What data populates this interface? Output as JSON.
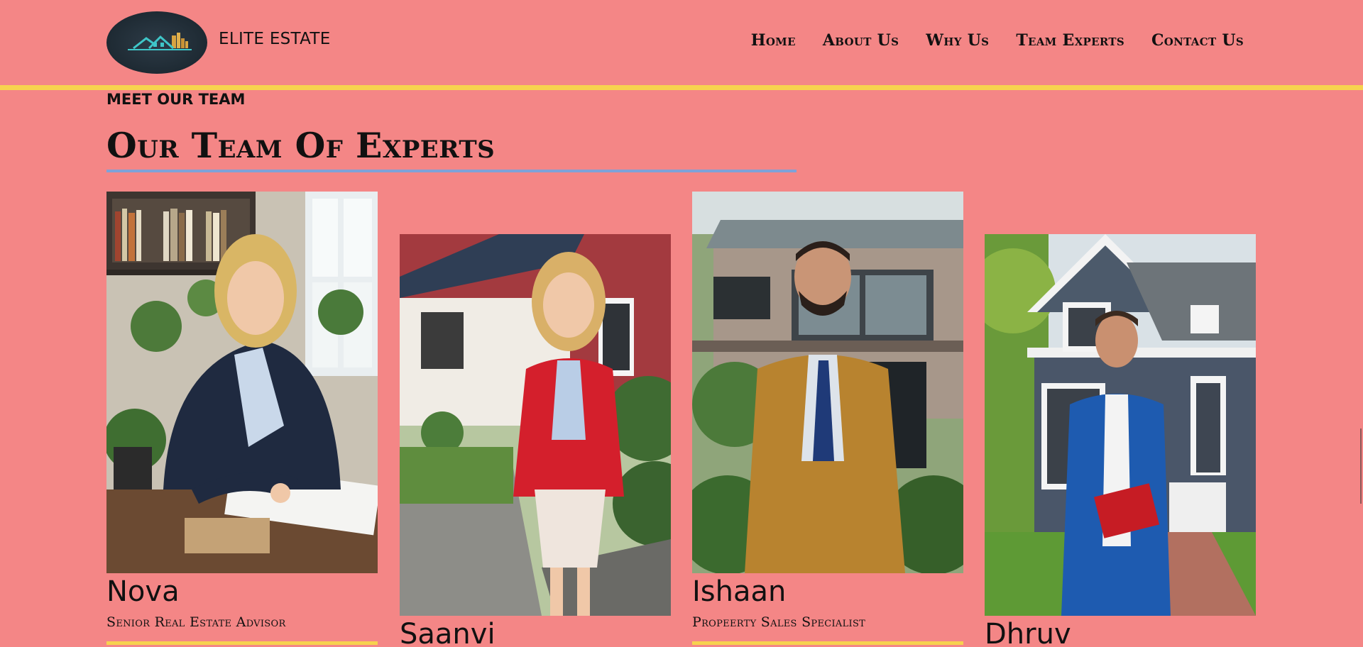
{
  "header": {
    "brand": "ELITE ESTATE",
    "logo_icon": "house-skyline-logo",
    "nav": [
      "Home",
      "About Us",
      "Why Us",
      "Team Experts",
      "Contact Us"
    ]
  },
  "section": {
    "eyebrow": "MEET OUR TEAM",
    "title": "Our Team Of Experts"
  },
  "team": [
    {
      "name": "Nova",
      "role": "Senior Real Estate Advisor"
    },
    {
      "name": "Saanvi",
      "role": ""
    },
    {
      "name": "Ishaan",
      "role": "Propeerty Sales Specialist"
    },
    {
      "name": "Dhruv",
      "role": ""
    }
  ],
  "colors": {
    "background": "#f48686",
    "accent_yellow": "#f7d24e",
    "accent_blue": "#7fa2d8"
  }
}
